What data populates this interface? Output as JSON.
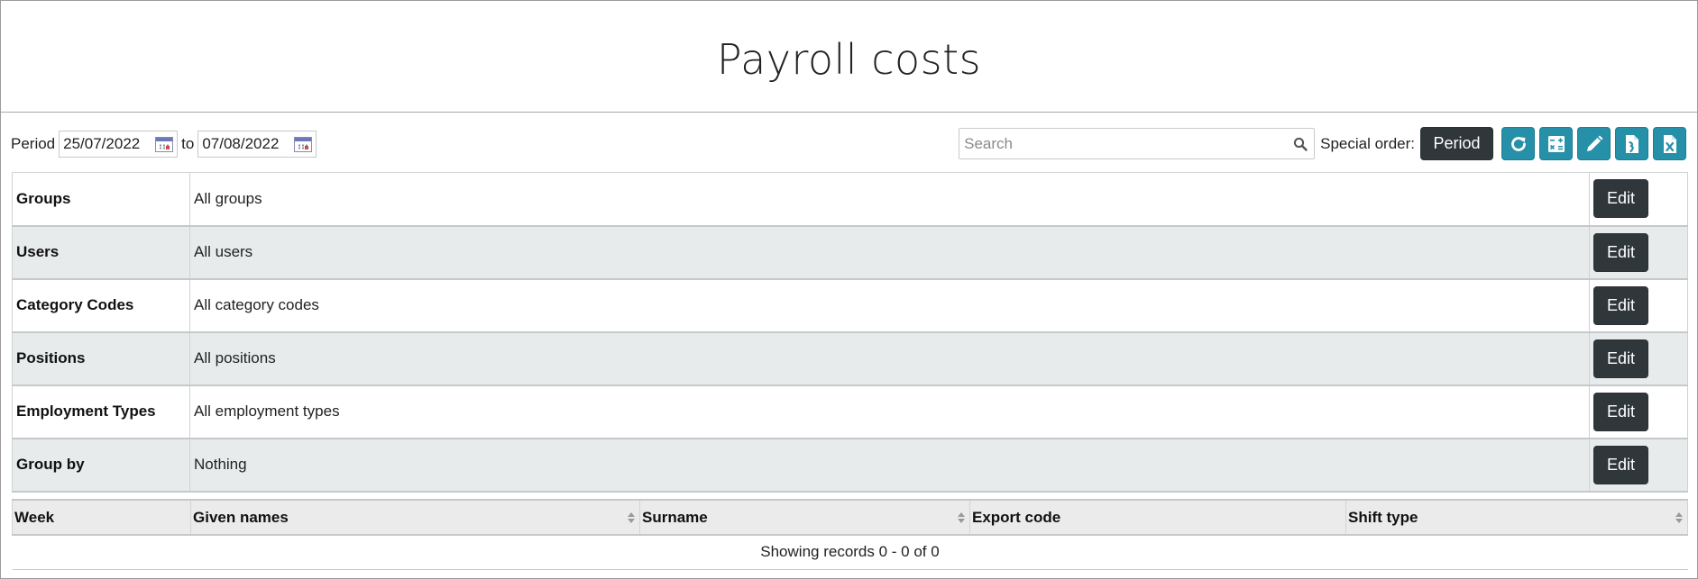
{
  "page": {
    "title": "Payroll costs"
  },
  "toolbar": {
    "period_label": "Period",
    "date_from": "25/07/2022",
    "to_label": "to",
    "date_to": "07/08/2022",
    "search_placeholder": "Search",
    "special_order_label": "Special order:",
    "period_button": "Period",
    "icons": [
      "refresh-icon",
      "calculator-icon",
      "pencil-icon",
      "export-file-icon",
      "excel-file-icon"
    ]
  },
  "filters": [
    {
      "name": "Groups",
      "value": "All groups",
      "button": "Edit"
    },
    {
      "name": "Users",
      "value": "All users",
      "button": "Edit"
    },
    {
      "name": "Category Codes",
      "value": "All category codes",
      "button": "Edit"
    },
    {
      "name": "Positions",
      "value": "All positions",
      "button": "Edit"
    },
    {
      "name": "Employment Types",
      "value": "All employment types",
      "button": "Edit"
    },
    {
      "name": "Group by",
      "value": "Nothing",
      "button": "Edit"
    }
  ],
  "table": {
    "columns": [
      "Week",
      "Given names",
      "Surname",
      "Export code",
      "Shift type"
    ],
    "rows": [],
    "info": "Showing records 0 - 0 of 0"
  },
  "colors": {
    "accent": "#2590a7",
    "dark_button": "#2f373b",
    "alt_row": "#e8ebeb"
  }
}
